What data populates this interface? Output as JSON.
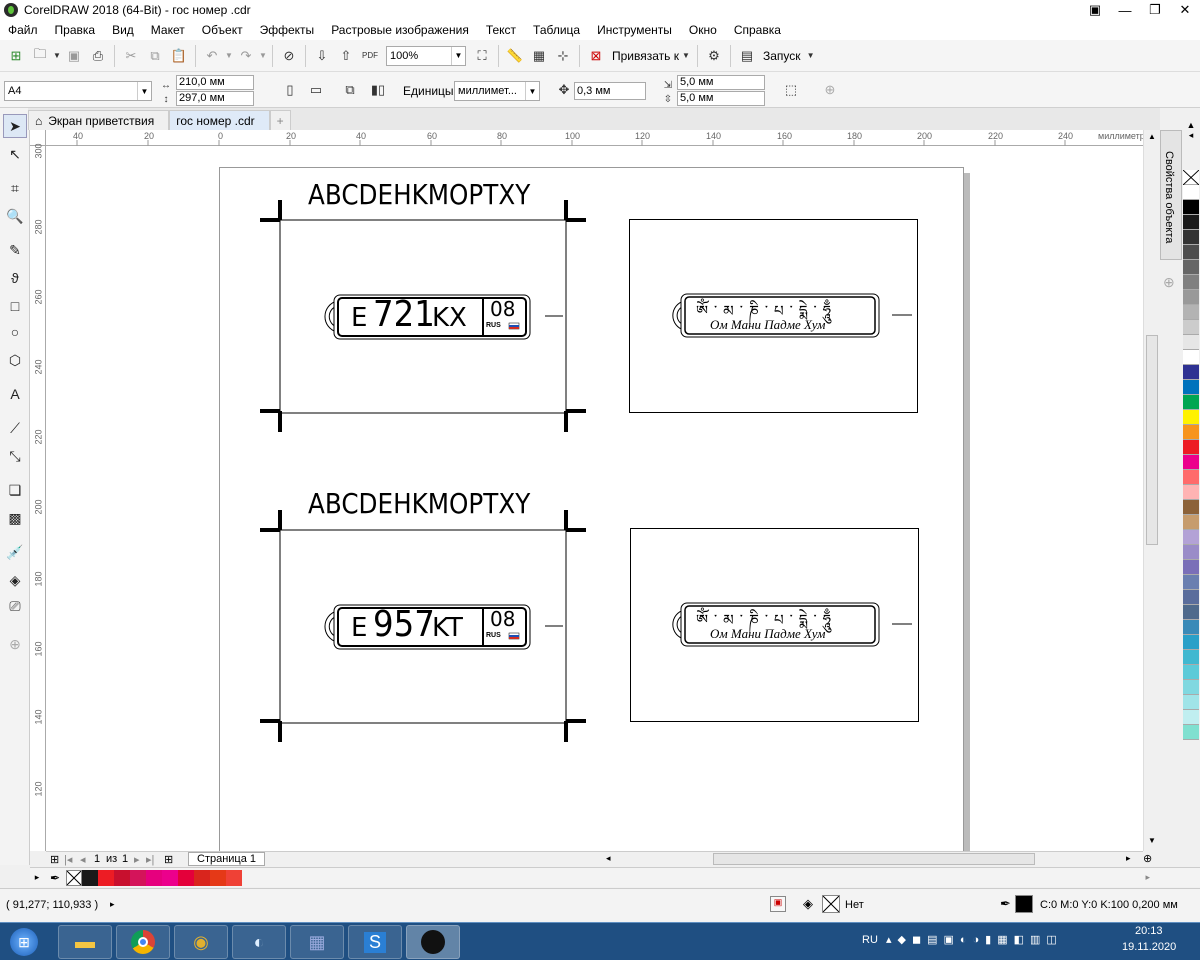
{
  "window": {
    "title": "CorelDRAW 2018 (64-Bit) - гос номер .cdr"
  },
  "menu": [
    "Файл",
    "Правка",
    "Вид",
    "Макет",
    "Объект",
    "Эффекты",
    "Растровые изображения",
    "Текст",
    "Таблица",
    "Инструменты",
    "Окно",
    "Справка"
  ],
  "toolbar": {
    "zoom": "100%",
    "snap_label": "Привязать к",
    "launch_label": "Запуск",
    "pdf_label": "PDF"
  },
  "property_bar": {
    "page_size": "A4",
    "width": "210,0 мм",
    "height": "297,0 мм",
    "units_label": "Единицы:",
    "units_value": "миллимет...",
    "nudge": "0,3 мм",
    "dup_x": "5,0 мм",
    "dup_y": "5,0 мм"
  },
  "tabs": {
    "welcome": "Экран приветствия",
    "document": "гос номер .cdr"
  },
  "ruler": {
    "units": "миллиметры",
    "h_ticks": [
      "40",
      "20",
      "0",
      "20",
      "40",
      "60",
      "80",
      "100",
      "120",
      "140",
      "160",
      "180",
      "200",
      "220",
      "240"
    ],
    "v_ticks": [
      "300",
      "280",
      "260",
      "240",
      "220",
      "200",
      "180",
      "160",
      "140",
      "120"
    ]
  },
  "docker": {
    "label": "Свойства объекта"
  },
  "design": {
    "alphabet_top": "ABCDEHKMOPTXY",
    "alphabet_bottom": "ABCDEHKMOPTXY",
    "plate1": {
      "letter1": "E",
      "digits": "721",
      "letters": "KX",
      "region": "08",
      "country": "RUS"
    },
    "plate2": {
      "letter1": "E",
      "digits": "957",
      "letters": "KT",
      "region": "08",
      "country": "RUS"
    },
    "mantra_script": "ༀ་མ་ཎི་པ་དྨེ་ཧཱུྃ",
    "mantra_text": "Ом Мани Падме Хум"
  },
  "page_nav": {
    "current": "1",
    "of": "из",
    "total": "1",
    "page_tab": "Страница 1"
  },
  "status": {
    "coords": "( 91,277; 110,933 )",
    "fill_none": "Нет",
    "outline_info": "C:0 M:0 Y:0 K:100  0,200 мм"
  },
  "taskbar": {
    "lang": "RU",
    "time": "20:13",
    "date": "19.11.2020"
  },
  "colors": {
    "accent": "#1f4f82",
    "palette": [
      "#ffffff",
      "#000000",
      "#1a1a1a",
      "#333333",
      "#4d4d4d",
      "#666666",
      "#808080",
      "#999999",
      "#b3b3b3",
      "#cccccc",
      "#e6e6e6",
      "#ffffff",
      "#2e3192",
      "#0072bc",
      "#00a651",
      "#fff200",
      "#f7941d",
      "#ed1c24",
      "#ec008c",
      "#ff6b6b",
      "#ffb3b3",
      "#8c6239",
      "#c69c6d",
      "#b3a2d6",
      "#9a8cc8",
      "#7a6fb8",
      "#6a7fb0",
      "#5a6d9c",
      "#4f6a8c",
      "#3a8ab8",
      "#2aa0c8",
      "#40b8d0",
      "#5ccad8",
      "#80d8e0",
      "#a0e4e8",
      "#c0eef0",
      "#80e0d0"
    ],
    "doc_palette": [
      "#1a1a1a",
      "#ed1c24",
      "#c8102e",
      "#d4145a",
      "#e6007e",
      "#ec008c",
      "#e4003a",
      "#d9251d",
      "#e53917",
      "#ef4136"
    ]
  }
}
